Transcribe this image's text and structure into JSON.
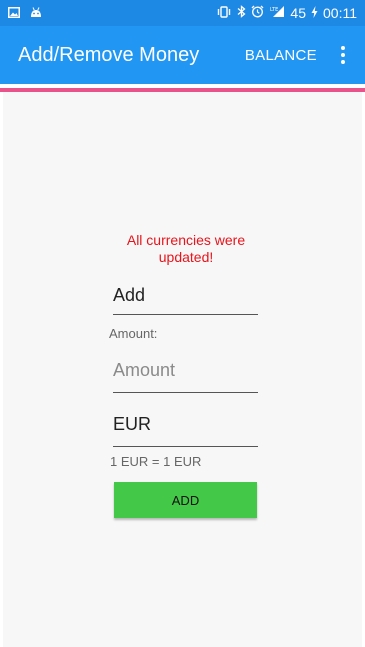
{
  "status_bar": {
    "battery": "45",
    "time": "00:11",
    "network": "LTE"
  },
  "app_bar": {
    "title": "Add/Remove Money",
    "balance_label": "BALANCE"
  },
  "colors": {
    "status_bar": "#1e88e5",
    "app_bar": "#2196f3",
    "accent_line": "#e8548a",
    "message_red": "#e8141b",
    "add_button": "#44c848"
  },
  "form": {
    "message": "All currencies were updated!",
    "operation_value": "Add",
    "amount_label": "Amount:",
    "amount_placeholder": "Amount",
    "currency_value": "EUR",
    "rate_text": "1 EUR = 1 EUR",
    "add_label": "ADD"
  }
}
